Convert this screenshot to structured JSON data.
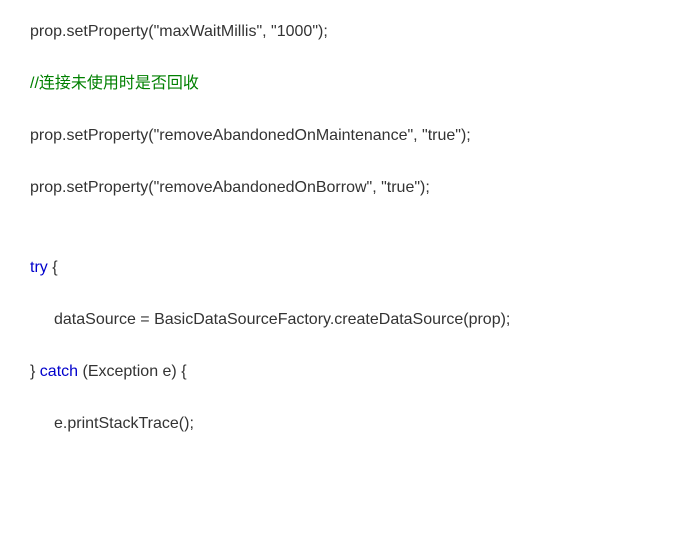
{
  "lines": {
    "l1": {
      "p1": "prop.setProperty(",
      "p2": "\"maxWaitMillis\"",
      "p3": ", ",
      "p4": "\"1000\"",
      "p5": ");"
    },
    "l2": {
      "comment": "//连接未使用时是否回收"
    },
    "l3": {
      "p1": "prop.setProperty(",
      "p2": "\"removeAbandonedOnMaintenance\"",
      "p3": ", ",
      "p4": "\"true\"",
      "p5": ");"
    },
    "l4": {
      "p1": "prop.setProperty(",
      "p2": "\"removeAbandonedOnBorrow\"",
      "p3": ", ",
      "p4": "\"true\"",
      "p5": ");"
    },
    "l5": {
      "kw": "try",
      "rest": " {"
    },
    "l6": {
      "text": "dataSource = BasicDataSourceFactory.createDataSource(prop);"
    },
    "l7": {
      "p1": "} ",
      "kw": "catch",
      "p2": " (Exception e) {"
    },
    "l8": {
      "text": "e.printStackTrace();"
    }
  }
}
